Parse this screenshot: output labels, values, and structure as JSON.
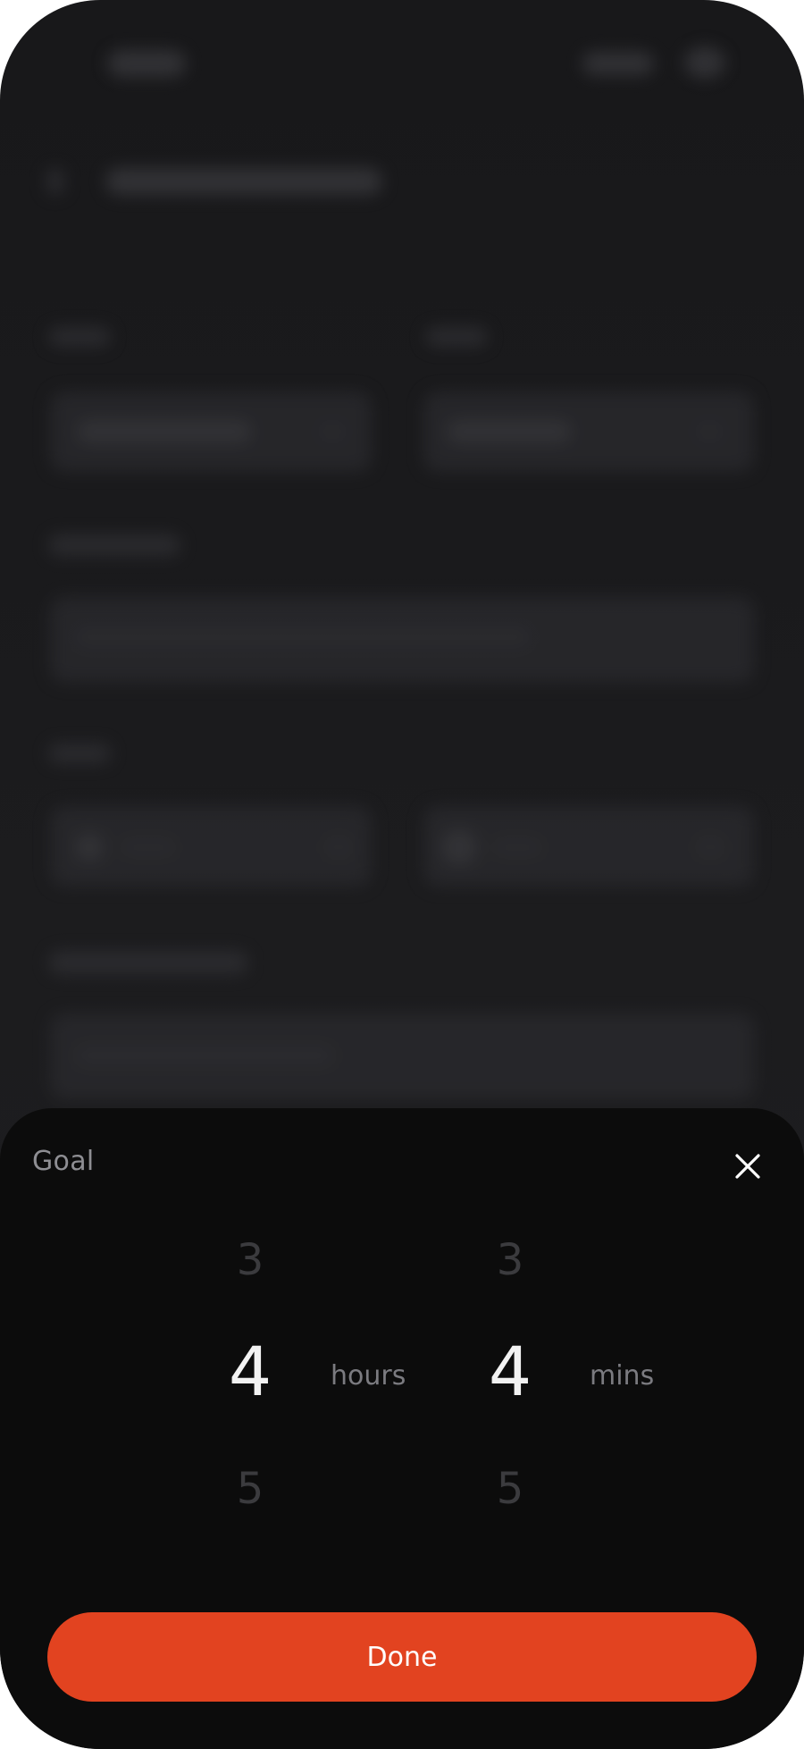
{
  "sheet": {
    "title": "Goal",
    "close_icon": "close-icon"
  },
  "picker": {
    "hours": {
      "above": "3",
      "selected": "4",
      "below": "5",
      "unit": "hours"
    },
    "minutes": {
      "above": "3",
      "selected": "4",
      "below": "5",
      "unit": "mins"
    }
  },
  "actions": {
    "done_label": "Done"
  },
  "colors": {
    "accent": "#e24320",
    "sheet_background": "#0c0c0c",
    "selected_value": "#f2f2f2",
    "faded_value": "#3b3b3e"
  }
}
